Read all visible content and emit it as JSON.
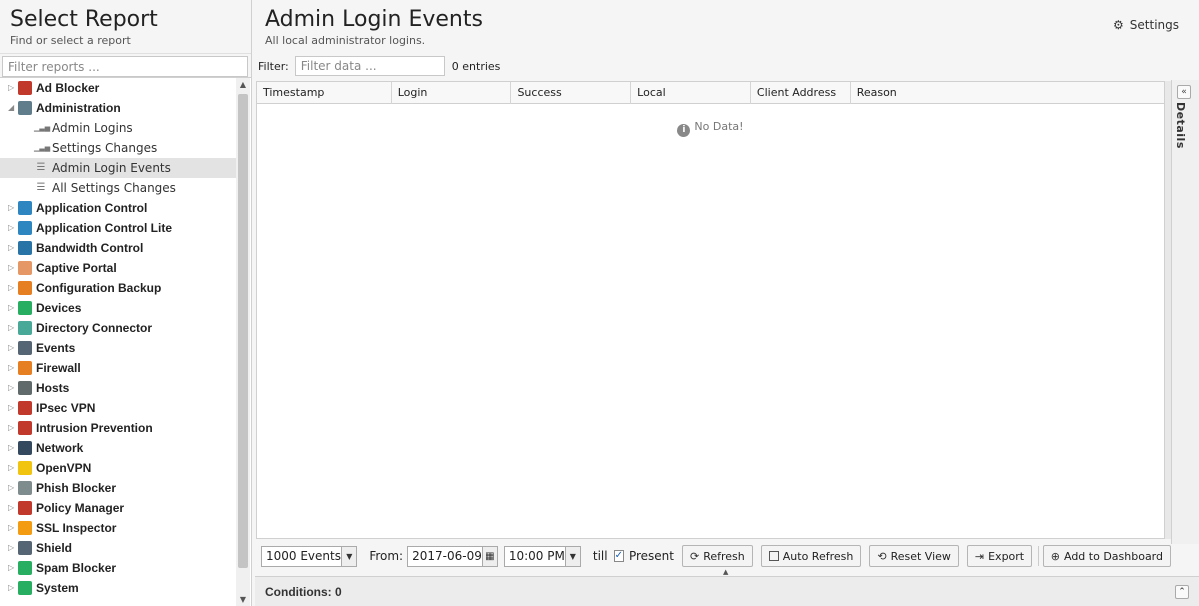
{
  "left": {
    "title": "Select Report",
    "subtitle": "Find or select a report",
    "filter_placeholder": "Filter reports ..."
  },
  "tree": [
    {
      "label": "Ad Blocker",
      "icon": "ad-blocker-icon",
      "color": "#c0392b",
      "expanded": false
    },
    {
      "label": "Administration",
      "icon": "administration-icon",
      "color": "#607d8b",
      "expanded": true,
      "children": [
        {
          "label": "Admin Logins",
          "icon": "bar-chart-icon"
        },
        {
          "label": "Settings Changes",
          "icon": "bar-chart-icon"
        },
        {
          "label": "Admin Login Events",
          "icon": "list-icon",
          "selected": true
        },
        {
          "label": "All Settings Changes",
          "icon": "list-icon"
        }
      ]
    },
    {
      "label": "Application Control",
      "icon": "application-control-icon",
      "color": "#2e86c1"
    },
    {
      "label": "Application Control Lite",
      "icon": "application-control-lite-icon",
      "color": "#2e86c1"
    },
    {
      "label": "Bandwidth Control",
      "icon": "bandwidth-control-icon",
      "color": "#2874a6"
    },
    {
      "label": "Captive Portal",
      "icon": "captive-portal-icon",
      "color": "#e59866"
    },
    {
      "label": "Configuration Backup",
      "icon": "configuration-backup-icon",
      "color": "#e67e22"
    },
    {
      "label": "Devices",
      "icon": "devices-icon",
      "color": "#27ae60"
    },
    {
      "label": "Directory Connector",
      "icon": "directory-connector-icon",
      "color": "#48a999"
    },
    {
      "label": "Events",
      "icon": "events-icon",
      "color": "#566573"
    },
    {
      "label": "Firewall",
      "icon": "firewall-icon",
      "color": "#e67e22"
    },
    {
      "label": "Hosts",
      "icon": "hosts-icon",
      "color": "#616a6b"
    },
    {
      "label": "IPsec VPN",
      "icon": "ipsec-vpn-icon",
      "color": "#c0392b"
    },
    {
      "label": "Intrusion Prevention",
      "icon": "intrusion-prevention-icon",
      "color": "#c0392b"
    },
    {
      "label": "Network",
      "icon": "network-icon",
      "color": "#34495e"
    },
    {
      "label": "OpenVPN",
      "icon": "openvpn-icon",
      "color": "#f1c40f"
    },
    {
      "label": "Phish Blocker",
      "icon": "phish-blocker-icon",
      "color": "#7f8c8d"
    },
    {
      "label": "Policy Manager",
      "icon": "policy-manager-icon",
      "color": "#c0392b"
    },
    {
      "label": "SSL Inspector",
      "icon": "ssl-inspector-icon",
      "color": "#f39c12"
    },
    {
      "label": "Shield",
      "icon": "shield-icon",
      "color": "#566573"
    },
    {
      "label": "Spam Blocker",
      "icon": "spam-blocker-icon",
      "color": "#27ae60"
    },
    {
      "label": "System",
      "icon": "system-icon",
      "color": "#27ae60"
    }
  ],
  "main": {
    "title": "Admin Login Events",
    "subtitle": "All local administrator logins.",
    "settings_label": "Settings",
    "filter_label": "Filter:",
    "filter_placeholder": "Filter data ...",
    "entries": "0 entries",
    "no_data": "No Data!",
    "details_label": "Details"
  },
  "columns": [
    {
      "label": "Timestamp"
    },
    {
      "label": "Login"
    },
    {
      "label": "Success"
    },
    {
      "label": "Local"
    },
    {
      "label": "Client Address"
    },
    {
      "label": "Reason"
    }
  ],
  "toolbar": {
    "events_select": "1000 Events",
    "from_label": "From:",
    "from_date": "2017-06-09",
    "from_time": "10:00 PM",
    "till_label": "till",
    "present_label": "Present",
    "present_checked": true,
    "refresh_label": "Refresh",
    "auto_refresh_label": "Auto Refresh",
    "reset_view_label": "Reset View",
    "export_label": "Export",
    "add_to_dashboard_label": "Add to Dashboard"
  },
  "conditions": {
    "label": "Conditions: 0"
  }
}
